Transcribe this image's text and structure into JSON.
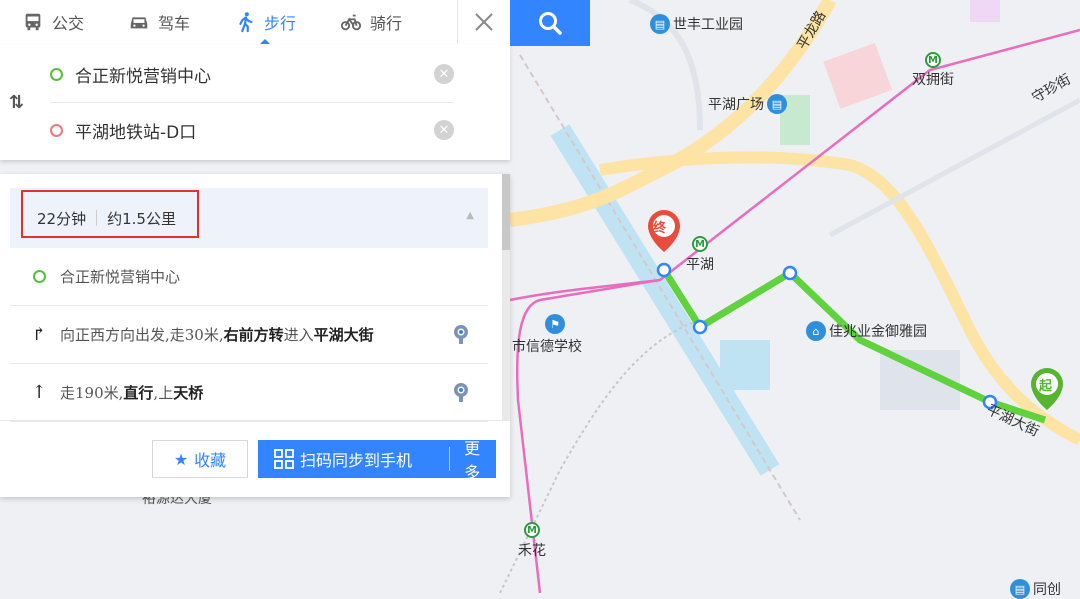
{
  "tabs": [
    {
      "label": "公交",
      "icon": "bus-icon"
    },
    {
      "label": "驾车",
      "icon": "car-icon"
    },
    {
      "label": "步行",
      "icon": "walk-icon",
      "active": true
    },
    {
      "label": "骑行",
      "icon": "bike-icon"
    }
  ],
  "route": {
    "start": "合正新悦营销中心",
    "end": "平湖地铁站-D口"
  },
  "summary": {
    "duration": "22分钟",
    "distance": "约1.5公里"
  },
  "steps": {
    "start": "合正新悦营销中心",
    "step1": {
      "a": "向正西方向出发,走30米,",
      "b": "右前方转",
      "c": "进入",
      "d": "平湖大街"
    },
    "step2": {
      "a": "走190米,",
      "b": "直行",
      "c": ",上",
      "d": "天桥"
    }
  },
  "footer": {
    "favorite": "收藏",
    "qr_sync": "扫码同步到手机",
    "more": "更多"
  },
  "map": {
    "labels": {
      "shifeng": "世丰工业园",
      "pingping": "平湖广场",
      "shuangyong": "双拥街",
      "pinghu": "平湖",
      "xinde": "市信德学校",
      "jiazhao": "佳兆业金御雅园",
      "pinghudajie": "平湖大街",
      "pinglong": "平龙路",
      "shouzhen": "守珍街",
      "hehua": "禾花",
      "yusheng": "裕源达大厦",
      "tonglu": "同创",
      "end_marker": "终",
      "start_marker": "起"
    },
    "colors": {
      "route": "#5fd23e",
      "metro": "#e96dbd",
      "road": "#fde3a4",
      "water": "#bfe3f3"
    }
  }
}
